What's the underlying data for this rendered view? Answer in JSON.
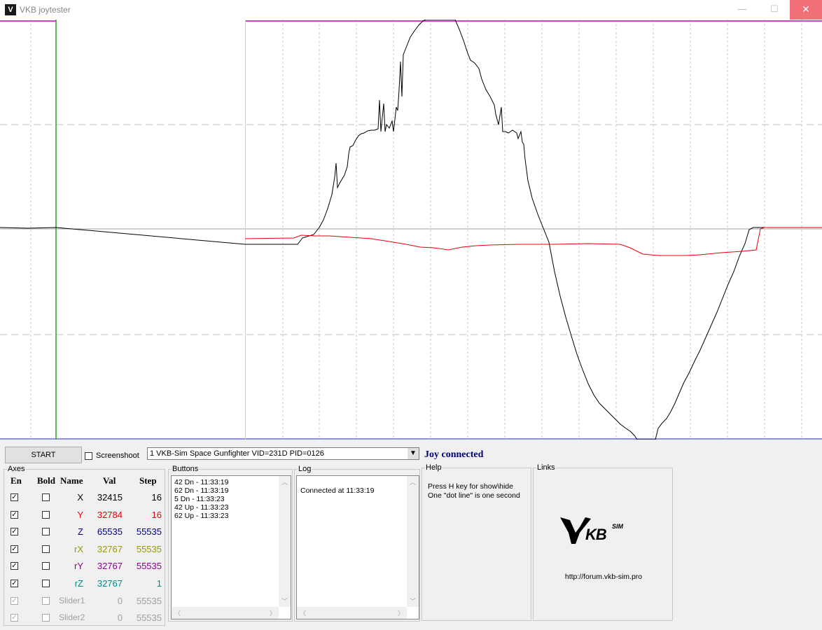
{
  "window": {
    "title": "VKB joytester",
    "minimize": "—",
    "maximize": "☐",
    "close": "✕"
  },
  "controls": {
    "start_label": "START",
    "screenshot_label": "Screenshoot",
    "device_selected": "1  VKB-Sim Space Gunfighter  VID=231D PID=0126",
    "status": "Joy connected"
  },
  "axes": {
    "label": "Axes",
    "headers": {
      "en": "En",
      "bold": "Bold",
      "name": "Name",
      "val": "Val",
      "step": "Step"
    },
    "rows": [
      {
        "name": "X",
        "val": "32415",
        "step": "16",
        "enabled": true,
        "bold": false,
        "color": "#000000"
      },
      {
        "name": "Y",
        "val": "32784",
        "step": "16",
        "enabled": true,
        "bold": false,
        "color": "#e8000b"
      },
      {
        "name": "Z",
        "val": "65535",
        "step": "55535",
        "enabled": true,
        "bold": false,
        "color": "#00008b"
      },
      {
        "name": "rX",
        "val": "32767",
        "step": "55535",
        "enabled": true,
        "bold": false,
        "color": "#9a9a00"
      },
      {
        "name": "rY",
        "val": "32767",
        "step": "55535",
        "enabled": true,
        "bold": false,
        "color": "#8b008b"
      },
      {
        "name": "rZ",
        "val": "32767",
        "step": "1",
        "enabled": true,
        "bold": false,
        "color": "#008b8b"
      },
      {
        "name": "Slider1",
        "val": "0",
        "step": "55535",
        "enabled": true,
        "bold": false,
        "color": "#a0a0a0"
      },
      {
        "name": "Slider2",
        "val": "0",
        "step": "55535",
        "enabled": true,
        "bold": false,
        "color": "#a0a0a0"
      }
    ]
  },
  "buttons_panel": {
    "label": "Buttons",
    "entries": [
      "42 Dn - 11:33:19",
      "62 Dn - 11:33:19",
      "5 Dn - 11:33:23",
      "42 Up - 11:33:23",
      "62 Up - 11:33:23"
    ]
  },
  "log_panel": {
    "label": "Log",
    "entries": [
      "Connected at 11:33:19"
    ]
  },
  "help_panel": {
    "label": "Help",
    "lines": [
      "Press H key for show\\hide",
      "One \"dot line\" is one second"
    ]
  },
  "links_panel": {
    "label": "Links",
    "logo_text": "KB",
    "logo_sup": "SIM",
    "url": "http://forum.vkb-sim.pro"
  },
  "graph_colors": {
    "axis_x": "#000000",
    "axis_y": "#e8000b",
    "limit_line": "#cc44cc",
    "bottom_line": "#9090e0",
    "center_line": "#a0a0a0",
    "grid": "#c8c8c8",
    "cursor": "#2a9d2a"
  }
}
